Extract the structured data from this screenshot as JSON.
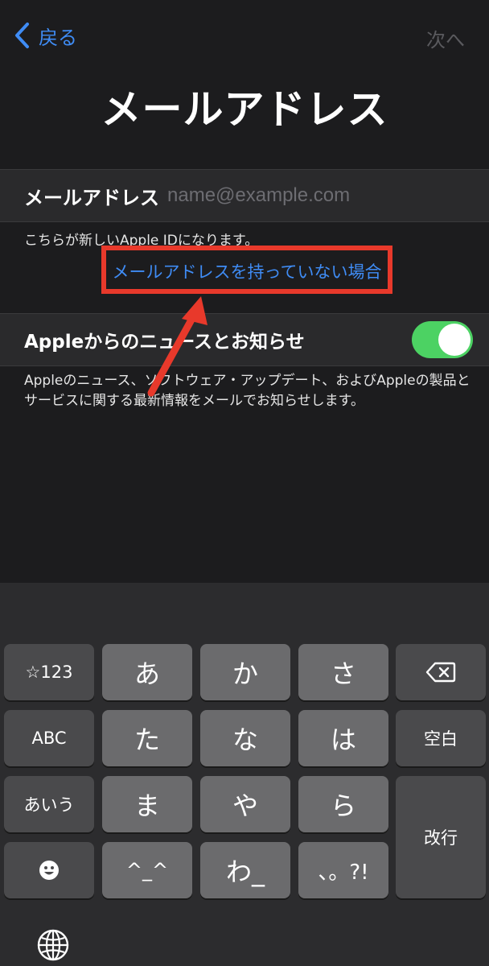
{
  "nav": {
    "back_label": "戻る",
    "next_label": "次へ"
  },
  "title": "メールアドレス",
  "email": {
    "label": "メールアドレス",
    "placeholder": "name@example.com",
    "value": ""
  },
  "note": "こちらが新しいApple IDになります。",
  "no_email_link": "メールアドレスを持っていない場合",
  "news": {
    "label": "Appleからのニュースとお知らせ",
    "enabled": true
  },
  "news_desc": "Appleのニュース、ソフトウェア・アップデート、およびAppleの製品とサービスに関する最新情報をメールでお知らせします。",
  "keyboard": {
    "symbols": "☆123",
    "a": "あ",
    "ka": "か",
    "sa": "さ",
    "abc": "ABC",
    "ta": "た",
    "na": "な",
    "ha": "は",
    "space": "空白",
    "kana": "あいう",
    "ma": "ま",
    "ya": "や",
    "ra": "ら",
    "enter": "改行",
    "emoticon": "^_^",
    "wa": "わ_",
    "punct": "、。?!"
  },
  "colors": {
    "accent": "#3f8cf5",
    "toggle_on": "#4cd263",
    "annotation": "#e8392b"
  }
}
